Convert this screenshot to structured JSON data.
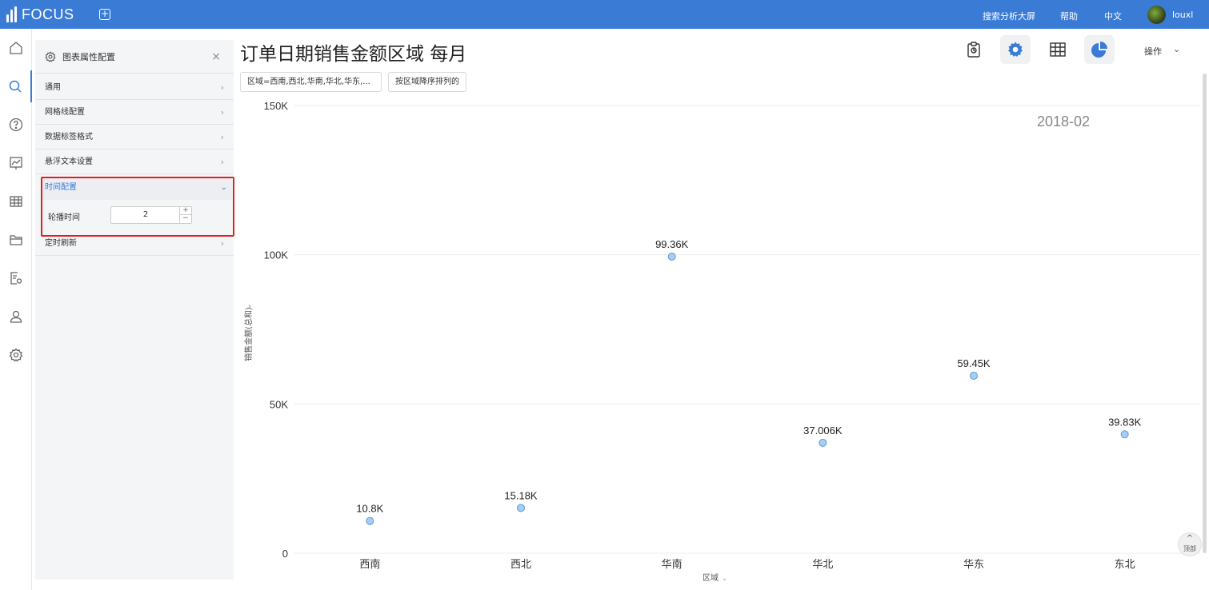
{
  "app": {
    "name": "FOCUS"
  },
  "topnav": {
    "links": [
      "搜索分析大屏",
      "帮助",
      "中文"
    ],
    "user": "louxl"
  },
  "panel": {
    "title": "图表属性配置",
    "close": "×",
    "rows": [
      "通用",
      "网格线配置",
      "数据标签格式",
      "悬浮文本设置"
    ],
    "time_section": "时间配置",
    "time_label": "轮播时间",
    "time_value": "2",
    "refresh": "定时刷新"
  },
  "main": {
    "title": "订单日期销售金额区域 每月",
    "filter_chip": "区域=西南,西北,华南,华北,华东,...",
    "sort_chip": "按区域降序排列的",
    "ops": "操作",
    "to_top": "顶部"
  },
  "colors": {
    "accent": "#3a7bd5",
    "point_fill": "#a7cdf2",
    "point_stroke": "#5b9bd5",
    "highlight": "#e02020"
  },
  "chart_data": {
    "type": "scatter",
    "annotation": "2018-02",
    "xlabel": "区域",
    "ylabel": "销售金额(总和)",
    "categories": [
      "西南",
      "西北",
      "华南",
      "华北",
      "华东",
      "东北"
    ],
    "values": [
      10800,
      15180,
      99360,
      37006,
      59450,
      39830
    ],
    "value_labels": [
      "10.8K",
      "15.18K",
      "99.36K",
      "37.006K",
      "59.45K",
      "39.83K"
    ],
    "y_ticks": [
      0,
      50000,
      100000,
      150000
    ],
    "y_tick_labels": [
      "0",
      "50K",
      "100K",
      "150K"
    ],
    "ylim": [
      0,
      150000
    ],
    "grid": true
  }
}
